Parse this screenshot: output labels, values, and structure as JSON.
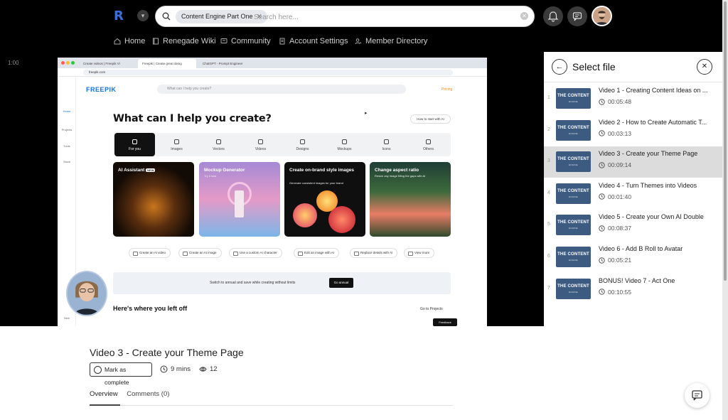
{
  "topbar": {
    "logo_letter": "R",
    "search_chip": "Content Engine Part One",
    "search_placeholder": "Search here...",
    "icons": [
      "bell-icon",
      "chat-icon",
      "avatar"
    ]
  },
  "nav": {
    "items": [
      {
        "label": "Home",
        "icon": "home-icon"
      },
      {
        "label": "Renegade Wiki",
        "icon": "book-icon"
      },
      {
        "label": "Community",
        "icon": "chat-icon"
      },
      {
        "label": "Account Settings",
        "icon": "document-icon"
      },
      {
        "label": "Member Directory",
        "icon": "people-icon"
      }
    ]
  },
  "video": {
    "timecode": "1:00",
    "browser": {
      "tabs": [
        "Create videos | Freepik Vi",
        "Freepik | Create great desig",
        "ChatGPT - Prompt Engineer"
      ],
      "url": "freepik.com"
    },
    "freepik": {
      "logo": "FREEPIK",
      "search_placeholder": "What can I help you create?",
      "pricing": "Pricing",
      "heading": "What can I help you create?",
      "how_to": "How to start with AI",
      "side_items": [
        "Home",
        "Projects",
        "Tools",
        "Stock",
        "New"
      ],
      "tabs": [
        "For you",
        "Images",
        "Vectors",
        "Videos",
        "Designs",
        "Mockups",
        "Icons",
        "Others"
      ],
      "cards": [
        {
          "title": "AI Assistant",
          "badge": "NEW",
          "sub": ""
        },
        {
          "title": "Mockup Generator",
          "badge": "",
          "sub": "Try it now"
        },
        {
          "title": "Create on-brand style images",
          "badge": "",
          "sub": "Generate consistent images for your brand"
        },
        {
          "title": "Change aspect ratio",
          "badge": "",
          "sub": "Resize any image filling the gaps with AI"
        }
      ],
      "pills": [
        "Create an AI video",
        "Create an AI image",
        "Use a custom AI character",
        "Edit an image with AI",
        "Replace details with AI",
        "View more"
      ],
      "banner_text": "Switch to annual and save while creating without limits",
      "banner_button": "Go annual",
      "left_off": "Here's where you left off",
      "go_projects": "Go to Projects",
      "feedback": "Feedback"
    }
  },
  "lesson": {
    "title": "Video 3 - Create your Theme Page",
    "mark_complete": "Mark as complete",
    "duration": "9 mins",
    "views": "12",
    "tabs": [
      "Overview",
      "Comments (0)"
    ]
  },
  "panel": {
    "title": "Select file",
    "thumb_label": "THE CONTENT",
    "thumb_sub": "ENGINE",
    "files": [
      {
        "num": "1",
        "title": "Video 1 - Creating Content Ideas on ...",
        "duration": "00:05:48",
        "active": false
      },
      {
        "num": "2",
        "title": "Video 2 - How to Create Automatic T...",
        "duration": "00:03:13",
        "active": false
      },
      {
        "num": "3",
        "title": "Video 3 - Create your Theme Page",
        "duration": "00:09:14",
        "active": true
      },
      {
        "num": "4",
        "title": "Video 4 - Turn Themes into Videos",
        "duration": "00:01:40",
        "active": false
      },
      {
        "num": "5",
        "title": "Video 5 - Create your Own AI Double",
        "duration": "00:08:37",
        "active": false
      },
      {
        "num": "6",
        "title": "Video 6 - Add B Roll to Avatar",
        "duration": "00:05:21",
        "active": false
      },
      {
        "num": "7",
        "title": "BONUS! Video 7 - Act One",
        "duration": "00:10:55",
        "active": false
      }
    ]
  },
  "colors": {
    "accent": "#3b6fd8",
    "thumb": "#3d5a80",
    "active_row": "#dcdcdc"
  }
}
